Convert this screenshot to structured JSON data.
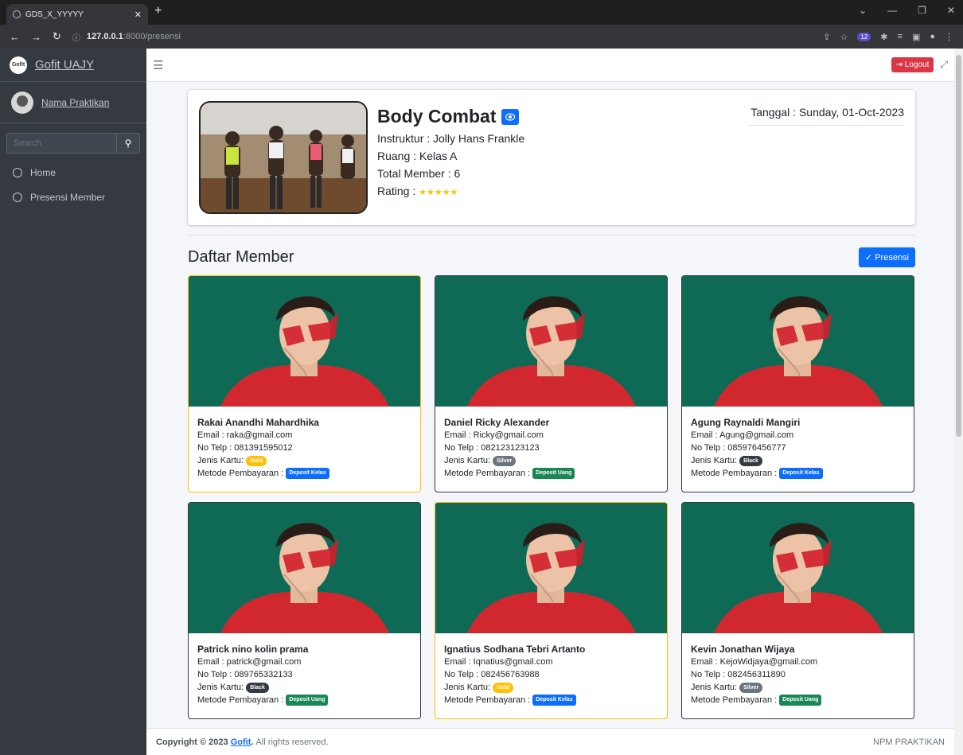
{
  "browser": {
    "tab_title": "GDS_X_YYYYY",
    "url_host": "127.0.0.1",
    "url_rest": ":8000/presensi"
  },
  "sidebar": {
    "brand_logo": "GofIt",
    "brand": "Gofit UAJY",
    "user_name": "Nama Praktikan",
    "search_placeholder": "Search",
    "items": [
      {
        "label": "Home"
      },
      {
        "label": "Presensi Member"
      }
    ]
  },
  "topbar": {
    "logout": "Logout"
  },
  "class": {
    "name": "Body Combat",
    "instructor": "Instruktur : Jolly Hans Frankle",
    "room": "Ruang : Kelas A",
    "total_member": "Total Member : 6",
    "rating_label": "Rating :",
    "rating_stars": "★★★★★",
    "date": "Tanggal : Sunday, 01-Oct-2023"
  },
  "members_section": {
    "title": "Daftar Member",
    "presensi_button": "Presensi"
  },
  "members": [
    {
      "name": "Rakai Anandhi Mahardhika",
      "email": "Email : raka@gmail.com",
      "phone": "No Telp : 081391595012",
      "card_label": "Jenis Kartu:",
      "card": "Gold",
      "pay_label": "Metode Pembayaran :",
      "payment": "Deposit Kelas"
    },
    {
      "name": "Daniel Ricky Alexander",
      "email": "Email : Ricky@gmail.com",
      "phone": "No Telp : 082123123123",
      "card_label": "Jenis Kartu:",
      "card": "Silver",
      "pay_label": "Metode Pembayaran :",
      "payment": "Deposit Uang"
    },
    {
      "name": "Agung Raynaldi Mangiri",
      "email": "Email : Agung@gmail.com",
      "phone": "No Telp : 085976456777",
      "card_label": "Jenis Kartu:",
      "card": "Black",
      "pay_label": "Metode Pembayaran :",
      "payment": "Deposit Kelas"
    },
    {
      "name": "Patrick nino kolin prama",
      "email": "Email : patrick@gmail.com",
      "phone": "No Telp : 089765332133",
      "card_label": "Jenis Kartu:",
      "card": "Black",
      "pay_label": "Metode Pembayaran :",
      "payment": "Deposit Uang"
    },
    {
      "name": "Ignatius Sodhana Tebri Artanto",
      "email": "Email : Iqnatius@gmail.com",
      "phone": "No Telp : 082456763988",
      "card_label": "Jenis Kartu:",
      "card": "Gold",
      "pay_label": "Metode Pembayaran :",
      "payment": "Deposit Kelas"
    },
    {
      "name": "Kevin Jonathan Wijaya",
      "email": "Email : KejoWidjaya@gmail.com",
      "phone": "No Telp : 082456311890",
      "card_label": "Jenis Kartu:",
      "card": "Silver",
      "pay_label": "Metode Pembayaran :",
      "payment": "Deposit Uang"
    }
  ],
  "footer": {
    "copyright": "Copyright © 2023",
    "brand_link": "Gofit",
    "rights": "All rights reserved.",
    "right_text": "NPM PRAKTIKAN"
  }
}
